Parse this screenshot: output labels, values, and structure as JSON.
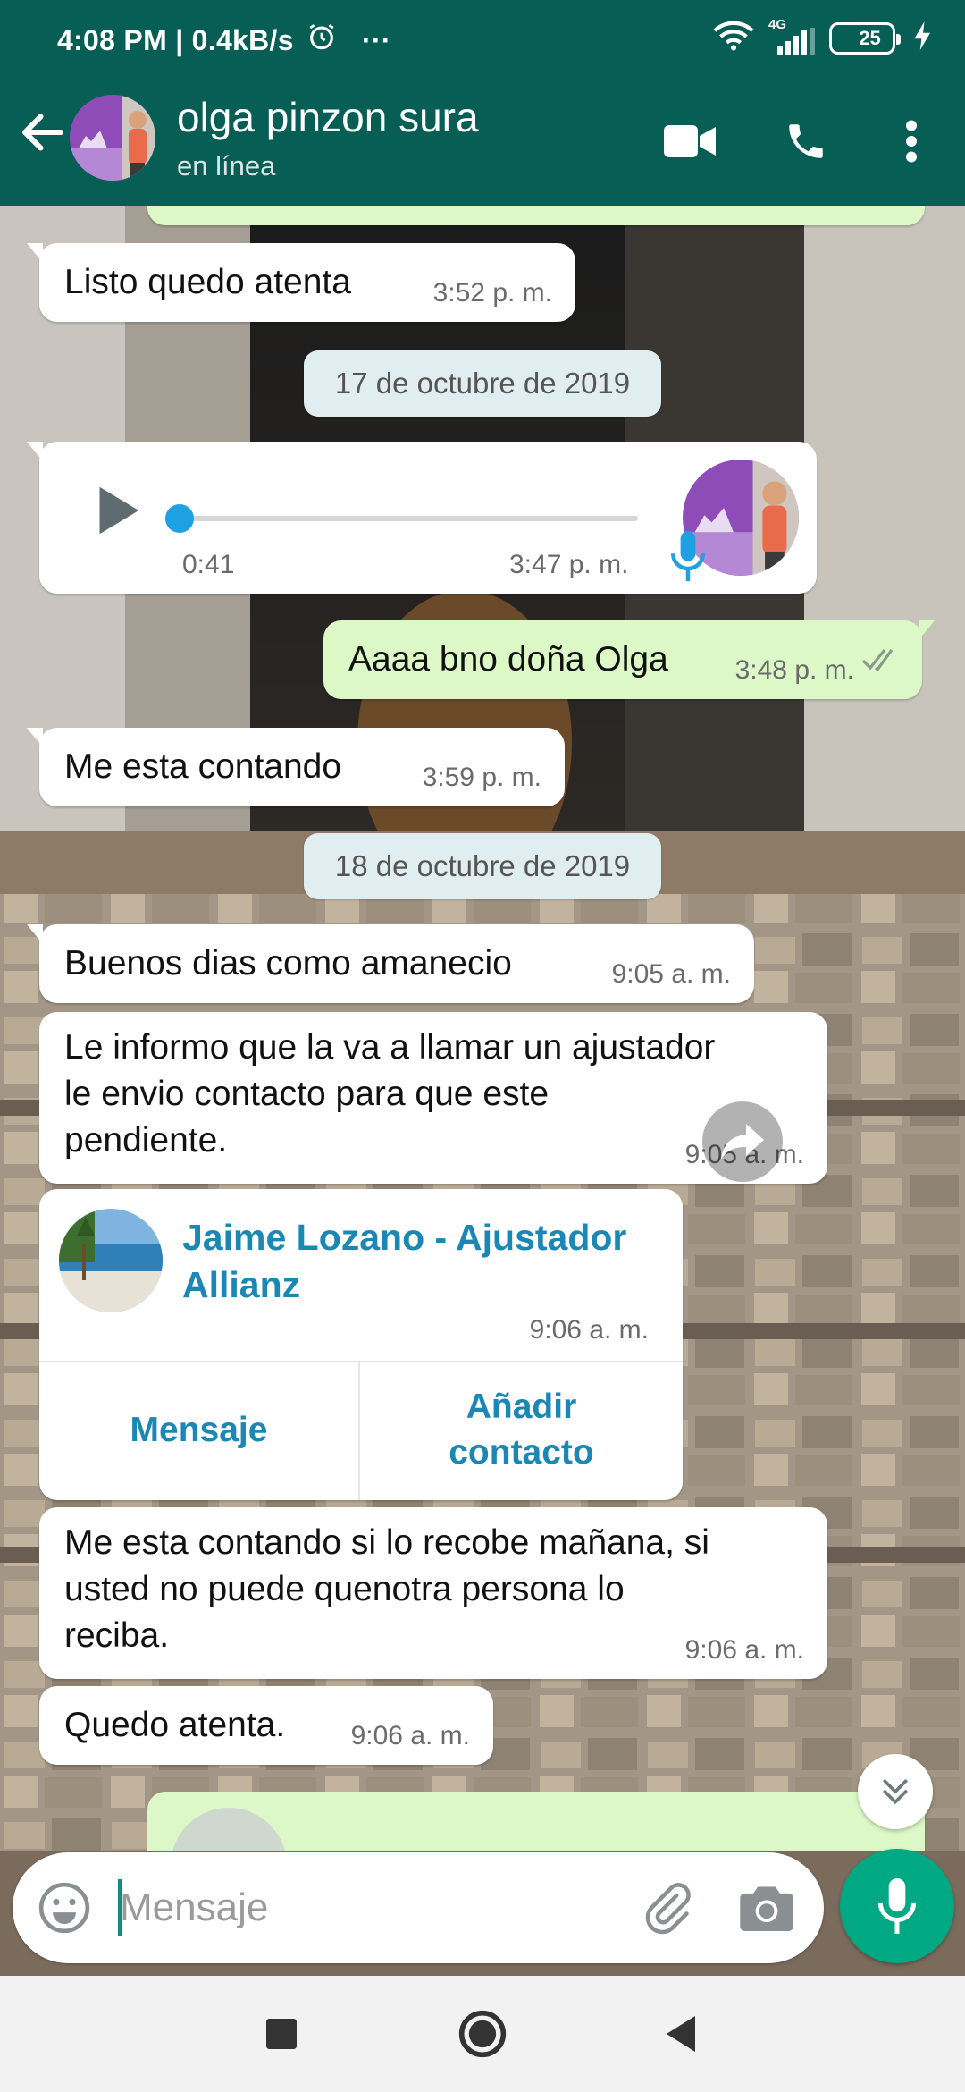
{
  "status_bar": {
    "time_speed": "4:08 PM | 0.4kB/s",
    "more": "···",
    "network": "4G",
    "battery": "25"
  },
  "header": {
    "contact_name": "olga pinzon sura",
    "contact_status": "en línea"
  },
  "colors": {
    "primary": "#075e54",
    "outgoing_bubble": "#dcf8c6",
    "accent": "#00a884",
    "link": "#1b87b5"
  },
  "messages": [
    {
      "dir": "in",
      "text": "Listo quedo atenta",
      "time": "3:52 p. m."
    },
    {
      "type": "date",
      "text": "17 de octubre de 2019"
    },
    {
      "type": "voice",
      "dir": "in",
      "duration": "0:41",
      "time": "3:47 p. m.",
      "progress": 0
    },
    {
      "dir": "out",
      "text": "Aaaa bno doña Olga",
      "time": "3:48 p. m."
    },
    {
      "dir": "in",
      "text": "Me esta contando",
      "time": "3:59 p. m."
    },
    {
      "type": "date",
      "text": "18 de octubre de 2019"
    },
    {
      "dir": "in",
      "text": "Buenos dias como amanecio",
      "time": "9:05 a. m."
    },
    {
      "dir": "in",
      "text": "Le informo que la va a llamar un ajustador le envio  contacto para que este pendiente.",
      "time": "9:05 a. m."
    },
    {
      "type": "contact",
      "dir": "in",
      "name": "Jaime Lozano - Ajustador Allianz",
      "time": "9:06 a. m.",
      "button_message": "Mensaje",
      "button_add": "Añadir contacto"
    },
    {
      "dir": "in",
      "text": "Me esta contando si lo recobe mañana, si usted no puede quenotra persona lo reciba.",
      "time": "9:06 a. m."
    },
    {
      "dir": "in",
      "text": "Quedo atenta.",
      "time": "9:06 a. m."
    }
  ],
  "bubbles": {
    "m1_text": "Listo quedo atenta",
    "m1_time": "3:52 p. m.",
    "d1": "17 de octubre de 2019",
    "voice_duration": "0:41",
    "voice_time": "3:47 p. m.",
    "m2_text": "Aaaa bno doña Olga",
    "m2_time": "3:48 p. m.",
    "m3_text": "Me esta contando",
    "m3_time": "3:59 p. m.",
    "d2": "18 de octubre de 2019",
    "m4_text": "Buenos dias como amanecio",
    "m4_time": "9:05 a. m.",
    "m5_line1": "Le informo que la va a llamar un ajustador",
    "m5_line2": "le envio  contacto para que este",
    "m5_line3": "pendiente.",
    "m5_time": "9:05 a. m.",
    "card_line1": "Jaime Lozano - Ajustador",
    "card_line2": "Allianz",
    "card_time": "9:06 a. m.",
    "card_btn_msg": "Mensaje",
    "card_btn_add1": "Añadir",
    "card_btn_add2": "contacto",
    "m6_line1": "Me esta contando si lo recobe mañana, si",
    "m6_line2": "usted no puede quenotra persona lo",
    "m6_line3": "reciba.",
    "m6_time": "9:06 a. m.",
    "m7_text": "Quedo atenta.",
    "m7_time": "9:06 a. m."
  },
  "composer": {
    "placeholder": "Mensaje"
  }
}
